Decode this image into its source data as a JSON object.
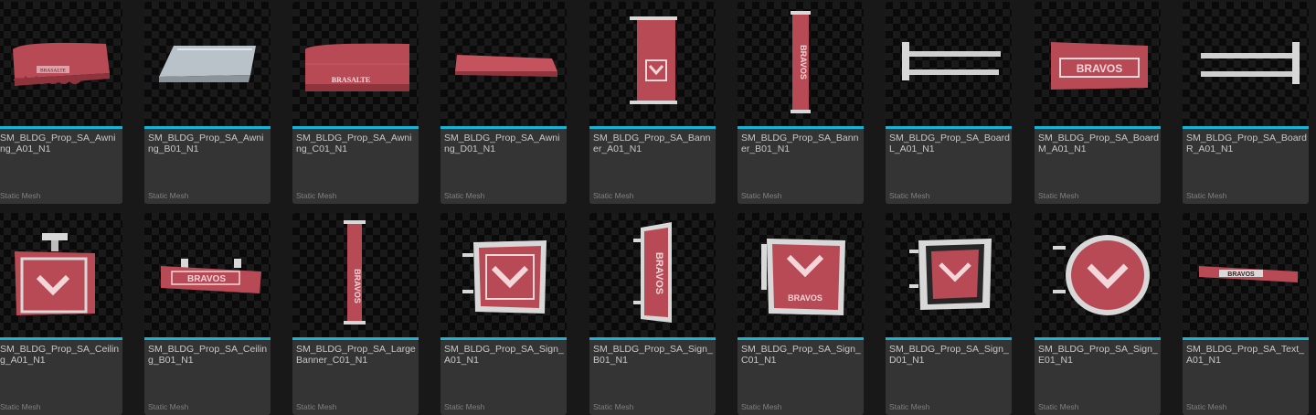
{
  "assets": [
    {
      "name": "SM_BLDG_Prop_SA_Awning_A01_N1",
      "type": "Static Mesh",
      "icon": "awning-red-icon"
    },
    {
      "name": "SM_BLDG_Prop_SA_Awning_B01_N1",
      "type": "Static Mesh",
      "icon": "awning-grey-icon"
    },
    {
      "name": "SM_BLDG_Prop_SA_Awning_C01_N1",
      "type": "Static Mesh",
      "icon": "awning-brasalte-icon"
    },
    {
      "name": "SM_BLDG_Prop_SA_Awning_D01_N1",
      "type": "Static Mesh",
      "icon": "awning-flat-icon"
    },
    {
      "name": "SM_BLDG_Prop_SA_Banner_A01_N1",
      "type": "Static Mesh",
      "icon": "banner-hanging-icon"
    },
    {
      "name": "SM_BLDG_Prop_SA_Banner_B01_N1",
      "type": "Static Mesh",
      "icon": "banner-vertical-icon"
    },
    {
      "name": "SM_BLDG_Prop_SA_BoardL_A01_N1",
      "type": "Static Mesh",
      "icon": "board-left-bracket-icon"
    },
    {
      "name": "SM_BLDG_Prop_SA_BoardM_A01_N1",
      "type": "Static Mesh",
      "icon": "board-sign-bravos-icon"
    },
    {
      "name": "SM_BLDG_Prop_SA_BoardR_A01_N1",
      "type": "Static Mesh",
      "icon": "board-right-bracket-icon"
    },
    {
      "name": "SM_BLDG_Prop_SA_Ceiling_A01_N1",
      "type": "Static Mesh",
      "icon": "ceiling-sign-icon"
    },
    {
      "name": "SM_BLDG_Prop_SA_Ceiling_B01_N1",
      "type": "Static Mesh",
      "icon": "ceiling-bravos-icon"
    },
    {
      "name": "SM_BLDG_Prop_SA_LargeBanner_C01_N1",
      "type": "Static Mesh",
      "icon": "large-banner-icon"
    },
    {
      "name": "SM_BLDG_Prop_SA_Sign_A01_N1",
      "type": "Static Mesh",
      "icon": "sign-square-icon"
    },
    {
      "name": "SM_BLDG_Prop_SA_Sign_B01_N1",
      "type": "Static Mesh",
      "icon": "sign-vertical-icon"
    },
    {
      "name": "SM_BLDG_Prop_SA_Sign_C01_N1",
      "type": "Static Mesh",
      "icon": "sign-bravos-square-icon"
    },
    {
      "name": "SM_BLDG_Prop_SA_Sign_D01_N1",
      "type": "Static Mesh",
      "icon": "sign-framed-icon"
    },
    {
      "name": "SM_BLDG_Prop_SA_Sign_E01_N1",
      "type": "Static Mesh",
      "icon": "sign-round-icon"
    },
    {
      "name": "SM_BLDG_Prop_SA_Text_A01_N1",
      "type": "Static Mesh",
      "icon": "sign-text-strip-icon"
    }
  ],
  "thumb_text": {
    "awning_a": "BRASALTE",
    "awning_c": "BRASALTE",
    "brand": "BRAVOS"
  },
  "colors": {
    "accent": "#19b3d6",
    "sign_red": "#b84a55",
    "metal": "#d8d8d8"
  }
}
